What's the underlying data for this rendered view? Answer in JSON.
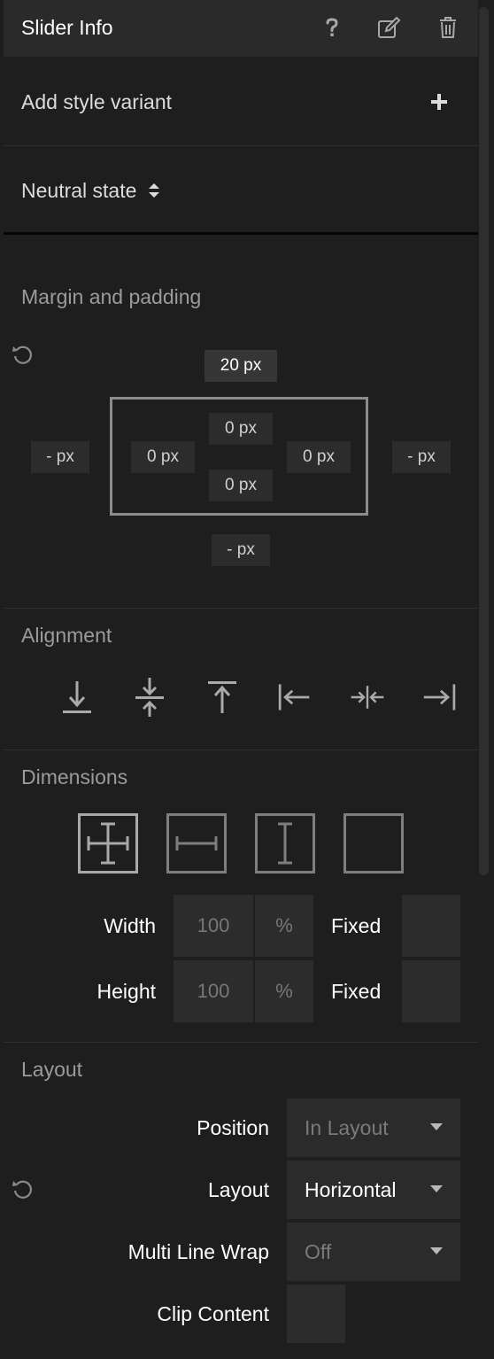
{
  "header": {
    "title": "Slider Info",
    "icons": [
      "help-icon",
      "edit-icon",
      "trash-icon"
    ]
  },
  "style_variant": {
    "label": "Add style variant",
    "icon": "plus-icon"
  },
  "state": {
    "label": "Neutral state",
    "icon": "sort-arrows-icon"
  },
  "margin_padding": {
    "title": "Margin and padding",
    "margin_top": "20 px",
    "margin_left": "- px",
    "margin_right": "- px",
    "margin_bottom": "- px",
    "padding_top": "0 px",
    "padding_left": "0 px",
    "padding_right": "0 px",
    "padding_bottom": "0 px"
  },
  "alignment": {
    "title": "Alignment",
    "icons": [
      "align-bottom-icon",
      "align-vertical-center-icon",
      "align-top-icon",
      "align-left-icon",
      "align-horizontal-center-icon",
      "align-right-icon"
    ]
  },
  "dimensions": {
    "title": "Dimensions",
    "icons": [
      "fill-both-icon",
      "fill-width-icon",
      "fill-height-icon",
      "fixed-size-icon"
    ],
    "width": {
      "label": "Width",
      "value": "100",
      "unit": "%",
      "mode": "Fixed"
    },
    "height": {
      "label": "Height",
      "value": "100",
      "unit": "%",
      "mode": "Fixed"
    }
  },
  "layout": {
    "title": "Layout",
    "position": {
      "label": "Position",
      "value": "In Layout"
    },
    "layout": {
      "label": "Layout",
      "value": "Horizontal"
    },
    "wrap": {
      "label": "Multi Line Wrap",
      "value": "Off"
    },
    "clip": {
      "label": "Clip Content"
    }
  }
}
